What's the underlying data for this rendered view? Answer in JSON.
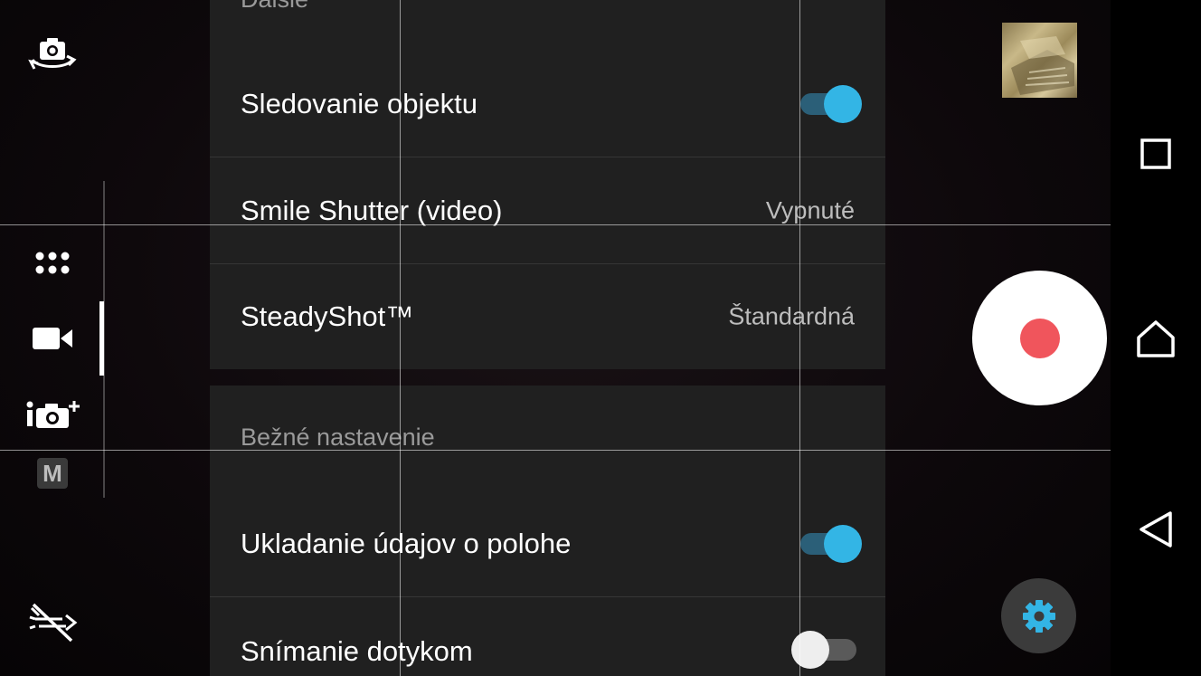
{
  "settings_panel": {
    "partial_header": "Ďalšie",
    "rows_top": [
      {
        "label": "Sledovanie objektu",
        "type": "toggle",
        "state": "on"
      },
      {
        "label": "Smile Shutter (video)",
        "type": "value",
        "value": "Vypnuté"
      },
      {
        "label": "SteadyShot™",
        "type": "value",
        "value": "Štandardná"
      }
    ],
    "section_header": "Bežné nastavenie",
    "rows_bottom": [
      {
        "label": "Ukladanie údajov o polohe",
        "type": "toggle",
        "state": "on"
      },
      {
        "label": "Snímanie dotykom",
        "type": "toggle",
        "state": "off"
      }
    ]
  },
  "left_rail": {
    "icons": [
      "switch-camera-icon",
      "apps-grid-icon",
      "video-mode-icon",
      "superior-auto-icon",
      "manual-mode-icon",
      "flash-off-icon"
    ],
    "manual_badge": "M",
    "active_mode": "video"
  },
  "right_column": {
    "icons": [
      "gallery-thumbnail",
      "record-icon",
      "gear-icon"
    ]
  },
  "navbar": {
    "icons": [
      "recents-icon",
      "home-icon",
      "back-icon"
    ]
  },
  "colors": {
    "accent": "#33b5e5",
    "record_red": "#f0555c",
    "panel_bg": "#202020",
    "toggle_track_on": "#2b5f78"
  }
}
